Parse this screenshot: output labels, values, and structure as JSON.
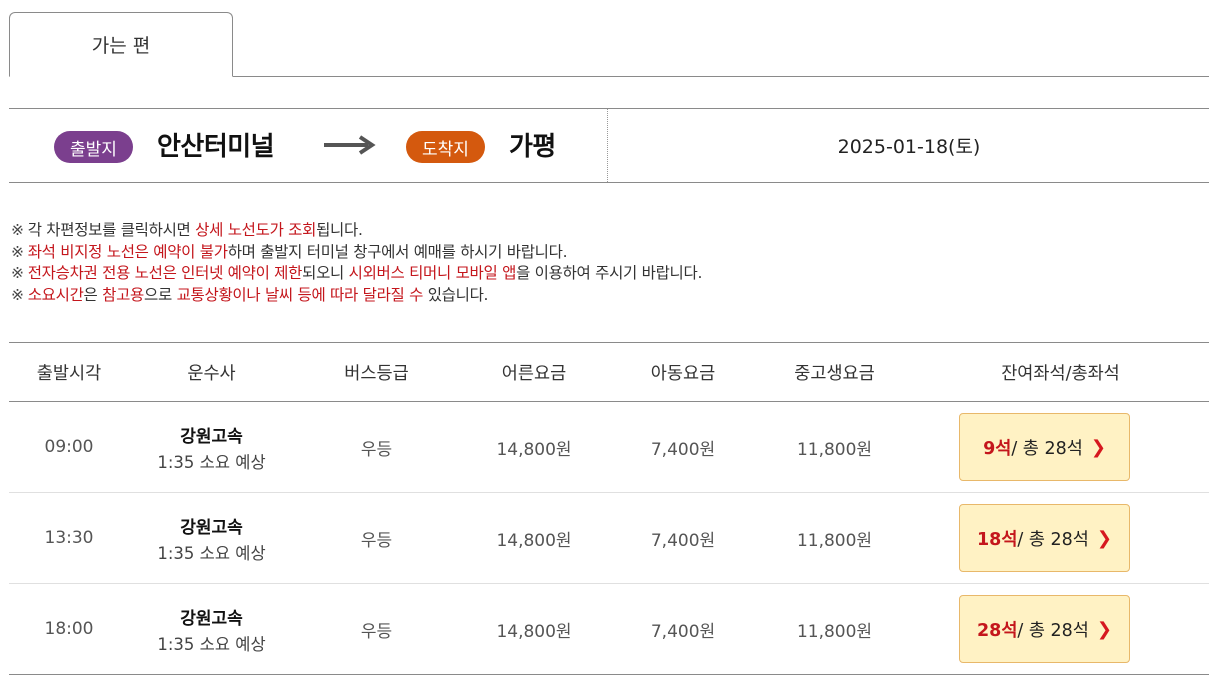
{
  "tab": {
    "label": "가는 편"
  },
  "route": {
    "departure_badge": "출발지",
    "departure_place": "안산터미널",
    "arrival_badge": "도착지",
    "arrival_place": "가평",
    "date": "2025-01-18(토)"
  },
  "notices": [
    {
      "segments": [
        {
          "t": "각 차편정보를 클릭하시면 ",
          "red": false
        },
        {
          "t": "상세 노선도가 조회",
          "red": true
        },
        {
          "t": "됩니다.",
          "red": false
        }
      ]
    },
    {
      "segments": [
        {
          "t": "좌석 비지정 노선은 예약이 불가",
          "red": true
        },
        {
          "t": "하며 출발지 터미널 창구에서 예매를 하시기 바랍니다.",
          "red": false
        }
      ]
    },
    {
      "segments": [
        {
          "t": "전자승차권 전용 노선은 인터넷 예약이 제한",
          "red": true
        },
        {
          "t": "되오니 ",
          "red": false
        },
        {
          "t": "시외버스 티머니 모바일 앱",
          "red": true
        },
        {
          "t": "을 이용하여 주시기 바랍니다.",
          "red": false
        }
      ]
    },
    {
      "segments": [
        {
          "t": "소요시간",
          "red": true
        },
        {
          "t": "은 ",
          "red": false
        },
        {
          "t": "참고용",
          "red": true
        },
        {
          "t": "으로 ",
          "red": false
        },
        {
          "t": "교통상황이나 날씨 등에 따라 달라질 수",
          "red": true
        },
        {
          "t": " 있습니다.",
          "red": false
        }
      ]
    }
  ],
  "notice_mark": "※",
  "table": {
    "headers": [
      "출발시각",
      "운수사",
      "버스등급",
      "어른요금",
      "아동요금",
      "중고생요금",
      "잔여좌석/총좌석"
    ],
    "rows": [
      {
        "time": "09:00",
        "company": "강원고속",
        "duration": "1:35 소요 예상",
        "grade": "우등",
        "adult": "14,800원",
        "child": "7,400원",
        "youth": "11,800원",
        "remain": "9석",
        "total": " / 총 28석"
      },
      {
        "time": "13:30",
        "company": "강원고속",
        "duration": "1:35 소요 예상",
        "grade": "우등",
        "adult": "14,800원",
        "child": "7,400원",
        "youth": "11,800원",
        "remain": "18석",
        "total": " / 총 28석"
      },
      {
        "time": "18:00",
        "company": "강원고속",
        "duration": "1:35 소요 예상",
        "grade": "우등",
        "adult": "14,800원",
        "child": "7,400원",
        "youth": "11,800원",
        "remain": "28석",
        "total": " / 총 28석"
      }
    ]
  },
  "icons": {
    "route_arrow": "long-right-arrow-icon",
    "seat_chevron": "chevron-right-icon"
  },
  "colors": {
    "departure_badge": "#7b3f8e",
    "arrival_badge": "#d4590e",
    "notice_red": "#c4161c",
    "seat_button_bg": "#fff2c4"
  }
}
